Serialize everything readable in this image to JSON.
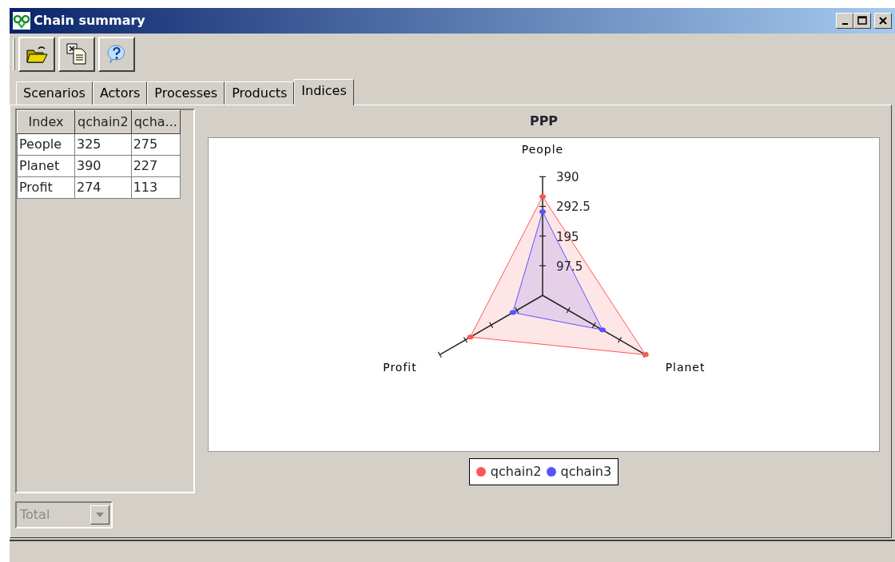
{
  "window": {
    "title": "Chain summary"
  },
  "tabs": [
    {
      "label": "Scenarios",
      "selected": false
    },
    {
      "label": "Actors",
      "selected": false
    },
    {
      "label": "Processes",
      "selected": false
    },
    {
      "label": "Products",
      "selected": false
    },
    {
      "label": "Indices",
      "selected": true
    }
  ],
  "table": {
    "columns": [
      "Index",
      "qchain2",
      "qcha..."
    ],
    "rows": [
      [
        "People",
        "325",
        "275"
      ],
      [
        "Planet",
        "390",
        "227"
      ],
      [
        "Profit",
        "274",
        "113"
      ]
    ]
  },
  "combo": {
    "value": "Total",
    "disabled": true
  },
  "chart": {
    "title": "PPP",
    "axes": [
      "People",
      "Planet",
      "Profit"
    ],
    "ticks": [
      "390",
      "292.5",
      "195",
      "97.5"
    ],
    "legend": [
      {
        "name": "qchain2",
        "color": "#ff5555"
      },
      {
        "name": "qchain3",
        "color": "#5555ff"
      }
    ]
  }
}
